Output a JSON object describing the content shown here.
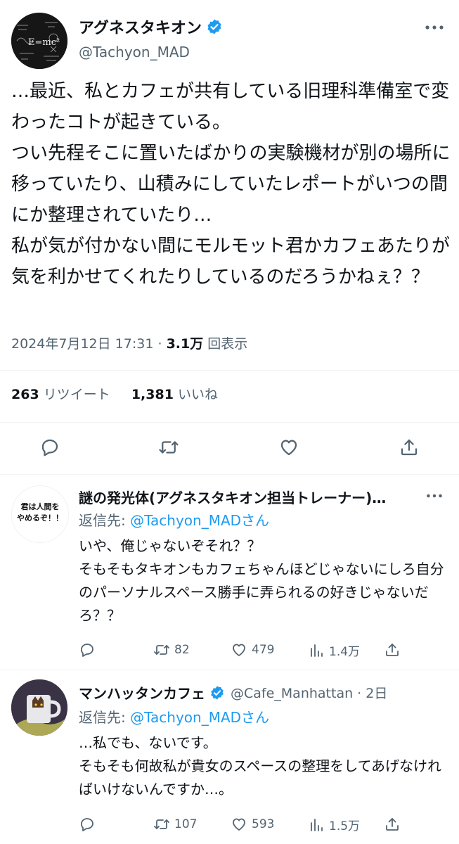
{
  "main_tweet": {
    "author_name": "アグネスタキオン",
    "handle": "@Tachyon_MAD",
    "text": "…最近、私とカフェが共有している旧理科準備室で変わったコトが起きている。\nつい先程そこに置いたばかりの実験機材が別の場所に移っていたり、山積みにしていたレポートがいつの間にか整理されていたり…\n私が気が付かない間にモルモット君かカフェあたりが気を利かせてくれたりしているのだろうかねぇ？？",
    "date": "2024年7月12日 17:31",
    "separator": "·",
    "views_count": "3.1万",
    "views_label": "回表示",
    "retweets_count": "263",
    "retweets_label": "リツイート",
    "likes_count": "1,381",
    "likes_label": "いいね"
  },
  "replies": [
    {
      "author_name": "謎の発光体(アグネスタキオン担当トレーナー)…",
      "avatar_text": "君は人間を\nやめるぞ！！",
      "reply_prefix": "返信先:",
      "reply_to": "@Tachyon_MADさん",
      "text": "いや、俺じゃないぞそれ？？\nそもそもタキオンもカフェちゃんほどじゃないにしろ自分のパーソナルスペース勝手に弄られるの好きじゃないだろ？？",
      "retweets": "82",
      "likes": "479",
      "views": "1.4万"
    },
    {
      "author_name": "マンハッタンカフェ",
      "handle_time": "@Cafe_Manhattan · 2日",
      "reply_prefix": "返信先:",
      "reply_to": "@Tachyon_MADさん",
      "text": "…私でも、ないです。\nそもそも何故私が貴女のスペースの整理をしてあげなければいけないんですか…。",
      "retweets": "107",
      "likes": "593",
      "views": "1.5万"
    }
  ],
  "colors": {
    "text": "#0f1419",
    "secondary": "#536471",
    "link": "#1d9bf0",
    "verified": "#1d9bf0",
    "divider": "#eff3f4"
  }
}
